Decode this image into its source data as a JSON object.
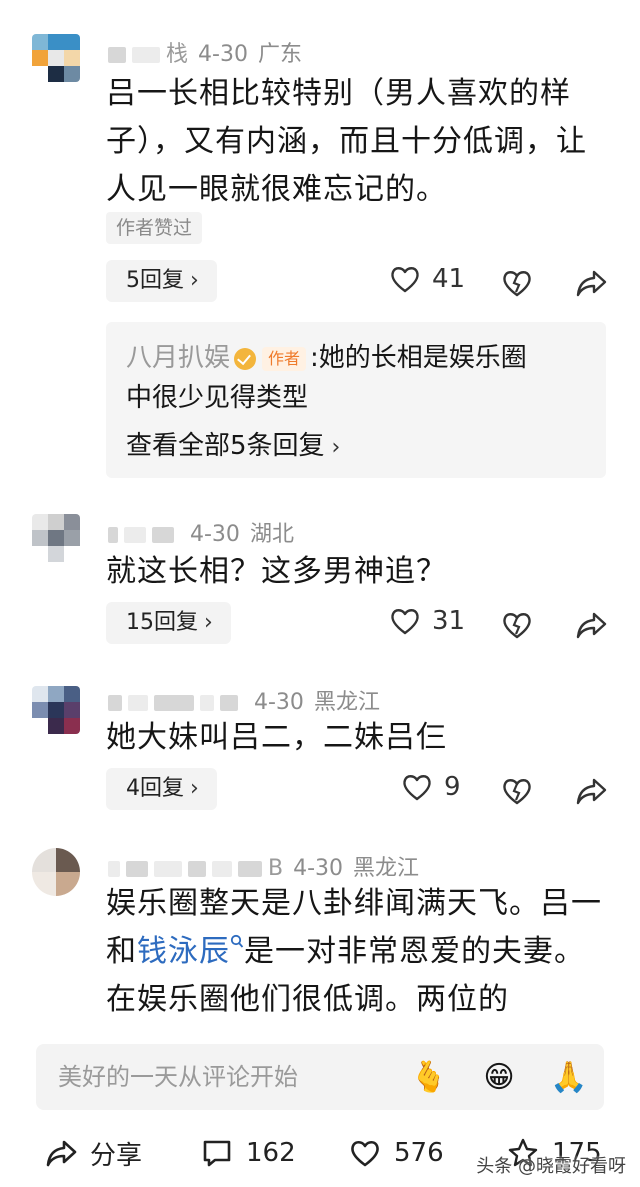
{
  "comments": [
    {
      "name_tail": "栈",
      "date": "4-30",
      "location": "广东",
      "text": "吕一长相比较特别（男人喜欢的样子），又有内涵，而且十分低调，让人见一眼就很难忘记的。",
      "author_liked_tag": "作者赞过",
      "reply_label": "5回复",
      "like_count": "41",
      "sub_reply": {
        "name": "八月扒娱",
        "author_badge": "作者",
        "text_line1": ":她的长相是娱乐圈",
        "text_line2": "中很少见得类型",
        "view_all": "查看全部5条回复"
      }
    },
    {
      "name_tail": "",
      "date": "4-30",
      "location": "湖北",
      "text": "就这长相？这多男神追？",
      "reply_label": "15回复",
      "like_count": "31"
    },
    {
      "name_tail": "",
      "date": "4-30",
      "location": "黑龙江",
      "text": "她大妹叫吕二，二妹吕仨",
      "reply_label": "4回复",
      "like_count": "9"
    },
    {
      "name_tail": "B",
      "date": "4-30",
      "location": "黑龙江",
      "text_part1": "娱乐圈整天是八卦绯闻满天飞。吕一和",
      "link_text": "钱泳辰",
      "text_part2": "是一对非常恩爱的夫妻。在娱乐圈他们很低调。两位的"
    }
  ],
  "input": {
    "placeholder": "美好的一天从评论开始",
    "emojis": [
      "🫰",
      "😁",
      "🙏"
    ]
  },
  "bottom_bar": {
    "share_label": "分享",
    "comment_count": "162",
    "like_count": "576",
    "star_count": "175"
  },
  "watermark": "头条 @晓霞好看呀",
  "colors": {
    "link": "#2d6bbf",
    "author_badge": "#ef7b2c",
    "verified": "#f3b53c"
  }
}
